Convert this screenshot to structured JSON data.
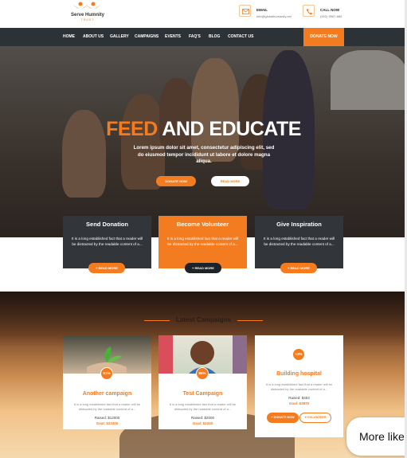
{
  "brand": {
    "name": "Serve Humnity",
    "tagline": "TRUST",
    "accent": "#f47c20",
    "dark": "#2d3237"
  },
  "contact": {
    "email_label": "EMAIL",
    "email_value": "info@globalhumanity.net",
    "phone_label": "CALL NOW",
    "phone_value": "(002) 9987-885"
  },
  "nav": {
    "items": [
      "HOME",
      "ABOUT US",
      "GALLERY",
      "CAMPAIGNS",
      "EVENTS",
      "FAQ'S",
      "BLOG",
      "CONTACT US"
    ],
    "donate": "DONATE NOW"
  },
  "hero": {
    "title_highlight": "FEED",
    "title_rest": " AND EDUCATE",
    "text": "Lorem ipsum dolor sit amet, consectetur adipiscing elit, sed do eiusmod tempor incididunt ut labore et dolore magna aliqua.",
    "btn_donate": "DONATE NOW",
    "btn_read": "READ MORE"
  },
  "features": [
    {
      "title": "Send Donation",
      "text": "It is a long established fact that a reader will be distracted by the readable content of a...",
      "button": "+ READ MORE"
    },
    {
      "title": "Become Volunteer",
      "text": "It is a long established fact that a reader will be distracted by the readable content of a...",
      "button": "+ READ MORE"
    },
    {
      "title": "Give Inspiration",
      "text": "It is a long established fact that a reader will be distracted by the readable content of a...",
      "button": "+ READ MORE"
    }
  ],
  "campaigns": {
    "heading": "Latest Campaigns",
    "cards": [
      {
        "percent": "51%",
        "title": "Another campaign",
        "text": "It is a long established fact that a reader will be distracted by the readable content of a...",
        "raised": "Raised: $12000",
        "goal": "Goal: $23400"
      },
      {
        "percent": "86%",
        "title": "Test Campaign",
        "text": "It is a long established fact that a reader will be distracted by the readable content of a...",
        "raised": "Raised: $2000",
        "goal": "Goal: $2340"
      },
      {
        "percent": "13%",
        "title": "Building hospital",
        "text": "It is a long established fact that a reader will be distracted by the readable content of a...",
        "raised": "Raised: $453",
        "goal": "Goal: $3870",
        "btn_donate": "+ DONATE NOW",
        "btn_vol": "♥ VOLUNTEER"
      }
    ]
  },
  "popup": {
    "more_like": "More like"
  }
}
